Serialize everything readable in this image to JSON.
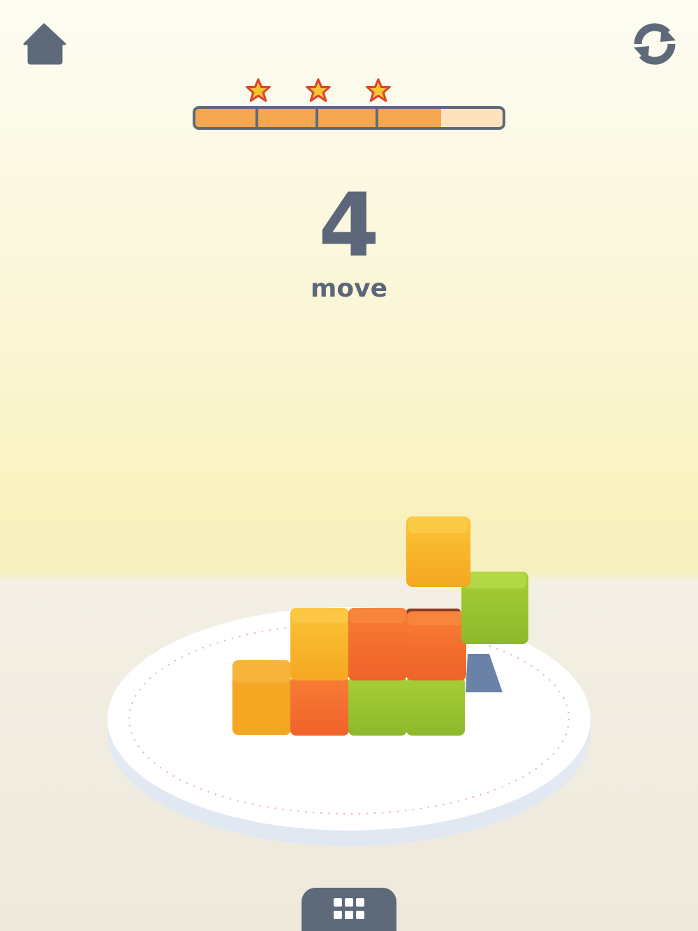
{
  "hud": {
    "home_icon": "home-icon",
    "restart_icon": "restart-icon",
    "menu_icon": "grid-menu-icon"
  },
  "progress": {
    "fill_fraction": 0.8,
    "segments": 5,
    "stars_earned": 3,
    "colors": {
      "fill": "#f4a750",
      "empty": "#fde2bd",
      "border": "#5e6a7a",
      "star": "#f7c531",
      "star_outline": "#e0442e"
    }
  },
  "moves": {
    "count": "4",
    "label": "move"
  },
  "colors": {
    "ui_dark": "#5e6a7a",
    "text": "#5c6779",
    "cube_yellow": "#f8b731",
    "cube_orange": "#f5702f",
    "cube_green": "#98c32e",
    "platform": "#ffffff"
  }
}
